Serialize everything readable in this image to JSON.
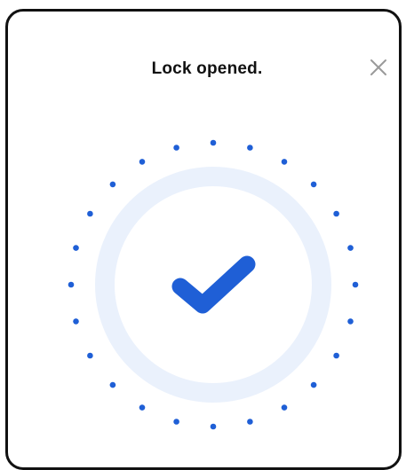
{
  "dialog": {
    "title": "Lock opened.",
    "close_icon": "close-icon",
    "status_icon": "checkmark-icon"
  },
  "colors": {
    "accent": "#1F5FD6",
    "ring": "#EAF1FC",
    "title": "#111111",
    "close": "#9A9A9A"
  }
}
